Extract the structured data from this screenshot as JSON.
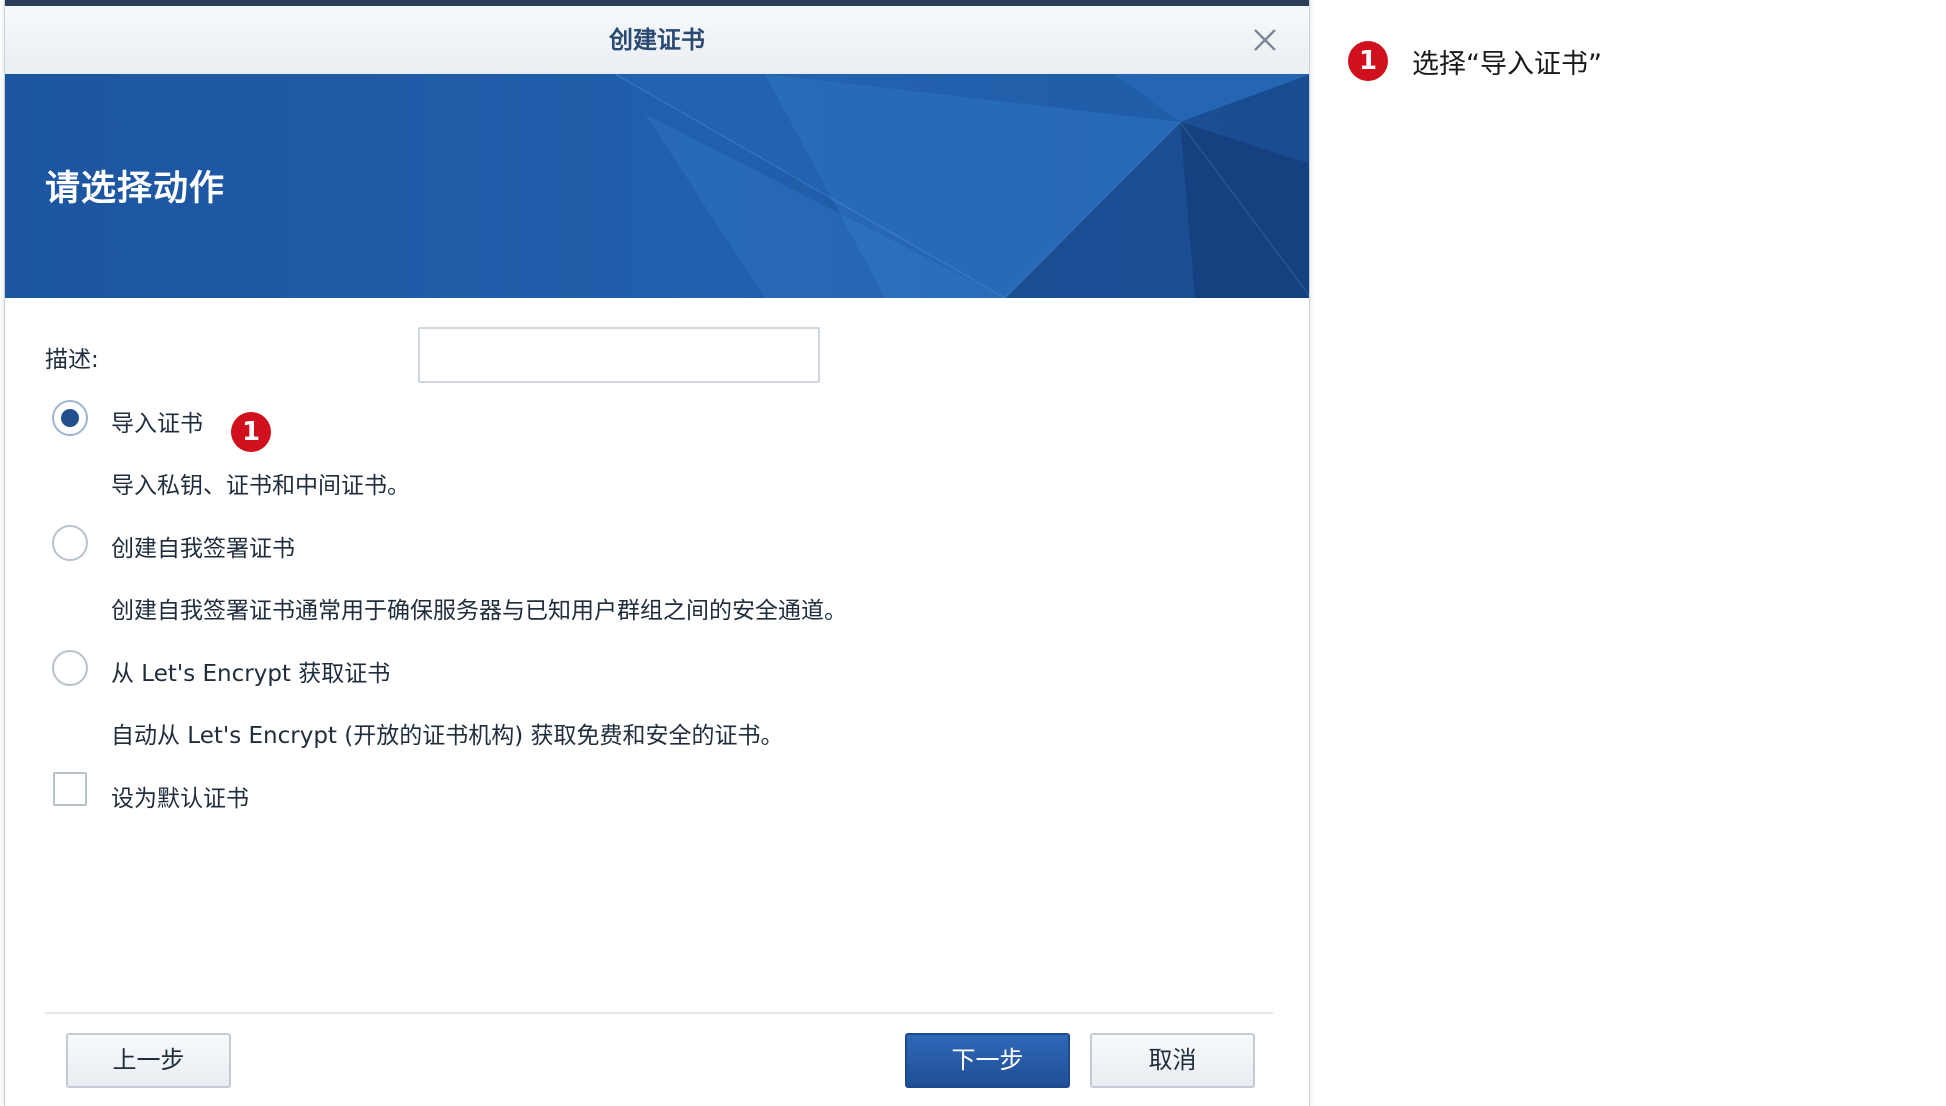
{
  "dialog": {
    "title": "创建证书",
    "banner_title": "请选择动作"
  },
  "form": {
    "description_label": "描述:",
    "description_value": "",
    "options": [
      {
        "label": "导入证书",
        "description": "导入私钥、证书和中间证书。",
        "selected": true
      },
      {
        "label": "创建自我签署证书",
        "description": "创建自我签署证书通常用于确保服务器与已知用户群组之间的安全通道。",
        "selected": false
      },
      {
        "label": "从 Let's Encrypt 获取证书",
        "description": "自动从 Let's Encrypt (开放的证书机构) 获取免费和安全的证书。",
        "selected": false
      }
    ],
    "default_checkbox_label": "设为默认证书",
    "default_checked": false
  },
  "footer": {
    "back_label": "上一步",
    "next_label": "下一步",
    "cancel_label": "取消"
  },
  "annotation": {
    "step_number": "1",
    "text": "选择“导入证书”"
  },
  "colors": {
    "banner_blue": "#1f59a6",
    "primary_button": "#2a5fab",
    "badge_red": "#d0111d",
    "title_text": "#2a4a74"
  }
}
